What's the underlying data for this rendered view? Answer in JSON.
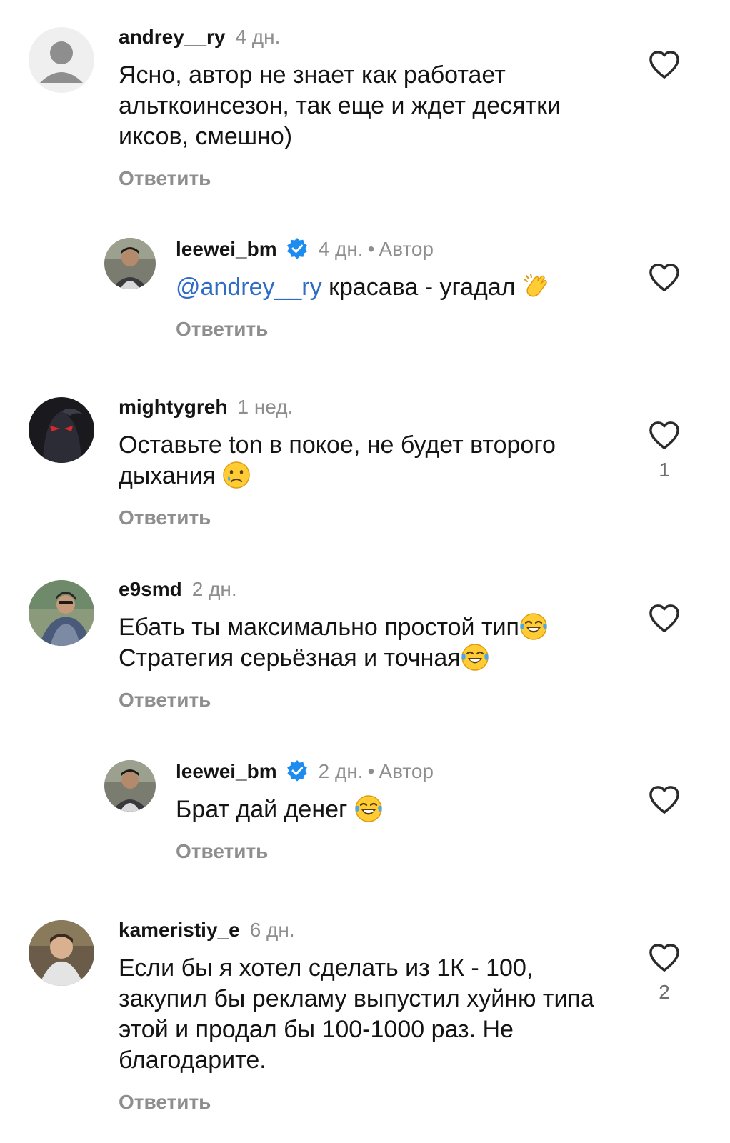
{
  "reply_label": "Ответить",
  "author_label": "Автор",
  "comments": [
    {
      "username": "andrey__ry",
      "time": "4 дн.",
      "text": "Ясно, автор не знает как работает альткоинсезон, так еще и ждет десятки иксов, смешно)",
      "likes": ""
    },
    {
      "username": "leewei_bm",
      "verified": true,
      "time": "4 дн.",
      "mention": "@andrey__ry",
      "text": " красава - угадал ",
      "emoji": "clapping-hands",
      "likes": ""
    },
    {
      "username": "mightygreh",
      "time": "1 нед.",
      "text": "Оставьте ton в покое, не будет второго дыхания ",
      "emoji": "crying-face",
      "likes": "1"
    },
    {
      "username": "e9smd",
      "time": "2 дн.",
      "text_line1": "Ебать ты максимально простой тип",
      "text_line2": "Стратегия серьёзная и точная",
      "emoji": "tears-of-joy",
      "likes": ""
    },
    {
      "username": "leewei_bm",
      "verified": true,
      "time": "2 дн.",
      "text": "Брат дай денег ",
      "emoji": "tears-of-joy",
      "likes": ""
    },
    {
      "username": "kameristiy_e",
      "time": "6 дн.",
      "text": "Если бы я хотел сделать из 1К - 100, закупил бы рекламу выпустил хуйню типа этой и продал бы 100-1000 раз. Не благодарите.",
      "likes": "2"
    }
  ],
  "colors": {
    "mention": "#2f6cc4",
    "verified": "#1d8cf0",
    "secondary": "#8e8e8e"
  }
}
